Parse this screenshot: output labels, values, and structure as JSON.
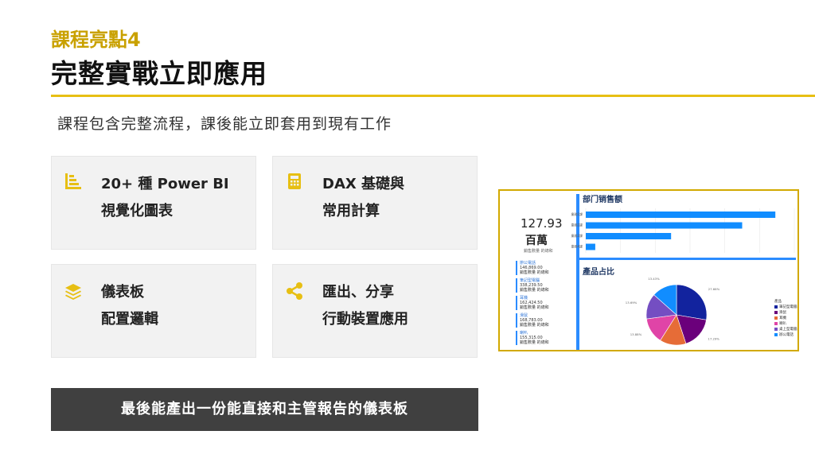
{
  "header": {
    "subtitle": "課程亮點4",
    "title": "完整實戰立即應用",
    "description": "課程包含完整流程，課後能立即套用到現有工作"
  },
  "features": [
    {
      "icon": "bar-chart-icon",
      "line1": "20+ 種 Power BI",
      "line2": "視覺化圖表"
    },
    {
      "icon": "calculator-icon",
      "line1": "DAX 基礎與",
      "line2": "常用計算"
    },
    {
      "icon": "layers-icon",
      "line1": "儀表板",
      "line2": "配置邏輯"
    },
    {
      "icon": "share-icon",
      "line1": "匯出、分享",
      "line2": "行動裝置應用"
    }
  ],
  "banner": "最後能產出一份能直接和主管報告的儀表板",
  "dashboard": {
    "bar_title": "部门销售额",
    "pie_title": "產品占比",
    "kpi_value": "127.93",
    "kpi_unit": "百萬",
    "kpi_caption": "銷售數量 的總和",
    "list": [
      {
        "name": "辦公電話",
        "value": "146,869.00",
        "caption": "銷售數量 的總和"
      },
      {
        "name": "筆記型電腦",
        "value": "338,239.50",
        "caption": "銷售數量 的總和"
      },
      {
        "name": "耳機",
        "value": "162,424.50",
        "caption": "銷售數量 的總和"
      },
      {
        "name": "滑鼠",
        "value": "168,783.00",
        "caption": "銷售數量 的總和"
      },
      {
        "name": "喇叭",
        "value": "155,315.00",
        "caption": "銷售數量 的總和"
      }
    ],
    "legend_title": "產品",
    "legend": [
      {
        "name": "筆記型電腦",
        "color": "#12239e"
      },
      {
        "name": "滑鼠",
        "color": "#6b007b"
      },
      {
        "name": "耳機",
        "color": "#e66c37"
      },
      {
        "name": "喇叭",
        "color": "#e044a7"
      },
      {
        "name": "桌上型電腦",
        "color": "#744ec2"
      },
      {
        "name": "辦公電話",
        "color": "#118dff"
      }
    ],
    "accent": "#2b8cff"
  },
  "chart_data": [
    {
      "type": "bar",
      "title": "部门销售额",
      "orientation": "horizontal",
      "categories": [
        "業務1課",
        "業務2課",
        "業務3課",
        "業務4課"
      ],
      "values": [
        40,
        33,
        18,
        2
      ],
      "xlim": [
        0,
        44
      ]
    },
    {
      "type": "pie",
      "title": "產品占比",
      "categories": [
        "筆記型電腦",
        "滑鼠",
        "耳機",
        "喇叭",
        "桌上型電腦",
        "辦公電話"
      ],
      "values": [
        27.66,
        17.29,
        14.05,
        13.88,
        13.69,
        13.43
      ],
      "colors": [
        "#12239e",
        "#6b007b",
        "#e66c37",
        "#e044a7",
        "#744ec2",
        "#118dff"
      ]
    }
  ]
}
